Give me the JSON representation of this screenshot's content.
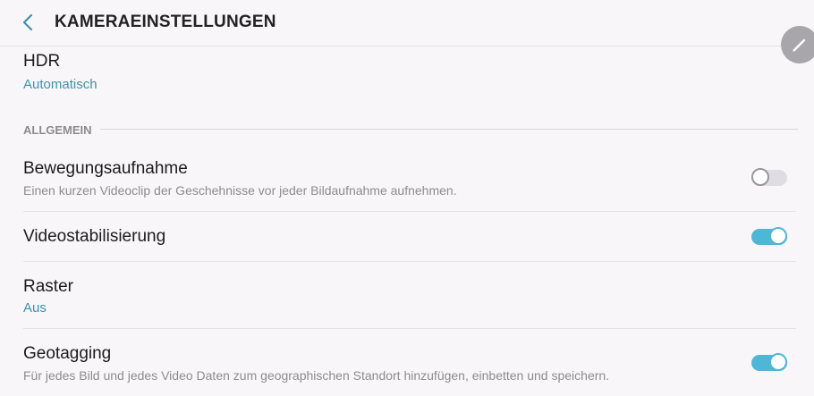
{
  "header": {
    "title": "KAMERAEINSTELLUNGEN",
    "back_icon": "chevron-left-icon",
    "edit_icon": "pencil-icon",
    "accent_color": "#4fb7d6"
  },
  "hdr": {
    "label": "HDR",
    "value": "Automatisch"
  },
  "section": {
    "title": "ALLGEMEIN"
  },
  "settings": [
    {
      "label": "Bewegungsaufnahme",
      "description": "Einen kurzen Videoclip der Geschehnisse vor jeder Bildaufnahme aufnehmen.",
      "toggle": "off"
    },
    {
      "label": "Videostabilisierung",
      "toggle": "on"
    },
    {
      "label": "Raster",
      "value": "Aus"
    },
    {
      "label": "Geotagging",
      "description": "Für jedes Bild und jedes Video Daten zum geographischen Standort hinzufügen, einbetten und speichern.",
      "toggle": "on"
    }
  ]
}
